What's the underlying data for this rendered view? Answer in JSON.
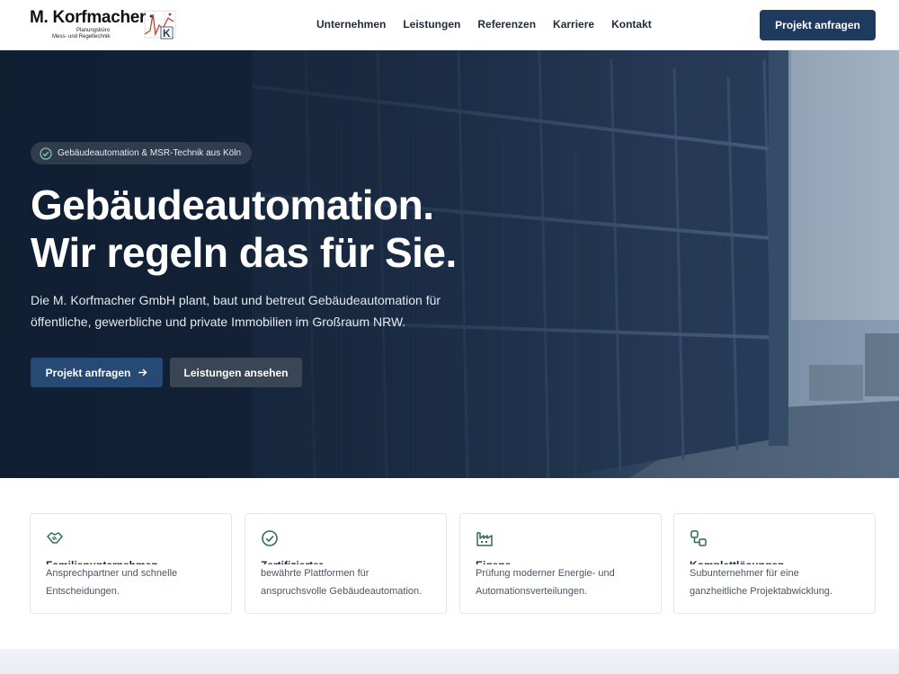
{
  "header": {
    "logo": {
      "name": "M. Korfmacher",
      "sub1": "Planungsbüro",
      "sub2": "Mess- und Regeltechnik",
      "mark_letter": "K"
    },
    "nav": [
      "Unternehmen",
      "Leistungen",
      "Referenzen",
      "Karriere",
      "Kontakt"
    ],
    "cta": "Projekt anfragen"
  },
  "hero": {
    "badge": "Gebäudeautomation & MSR-Technik aus Köln",
    "title_line1": "Gebäudeautomation.",
    "title_line2": "Wir regeln das für Sie.",
    "text_line1": "Die M. Korfmacher GmbH plant, baut und betreut Gebäudeautomation für",
    "text_line2": "öffentliche, gewerbliche und private Immobilien im Großraum NRW.",
    "primary_button": "Projekt anfragen",
    "secondary_button": "Leistungen ansehen"
  },
  "features": [
    {
      "icon": "handshake-icon",
      "title": "Familienunternehmen",
      "line1": "Ansprechpartner und schnelle",
      "line2": "Entscheidungen."
    },
    {
      "icon": "check-badge-icon",
      "title": "Zertifizierter",
      "line1": "bewährte Plattformen für",
      "line2": "anspruchsvolle Gebäudeautomation."
    },
    {
      "icon": "factory-icon",
      "title": "Eigene",
      "line1": "Prüfung moderner Energie- und",
      "line2": "Automationsverteilungen."
    },
    {
      "icon": "workflow-icon",
      "title": "Komplettlösungen",
      "line1": "Subunternehmer für eine",
      "line2": "ganzheitliche Projektabwicklung."
    }
  ],
  "colors": {
    "brand": "#1e3a5f",
    "icon_green": "#2f6b4f",
    "hero_dark": "#132338"
  }
}
